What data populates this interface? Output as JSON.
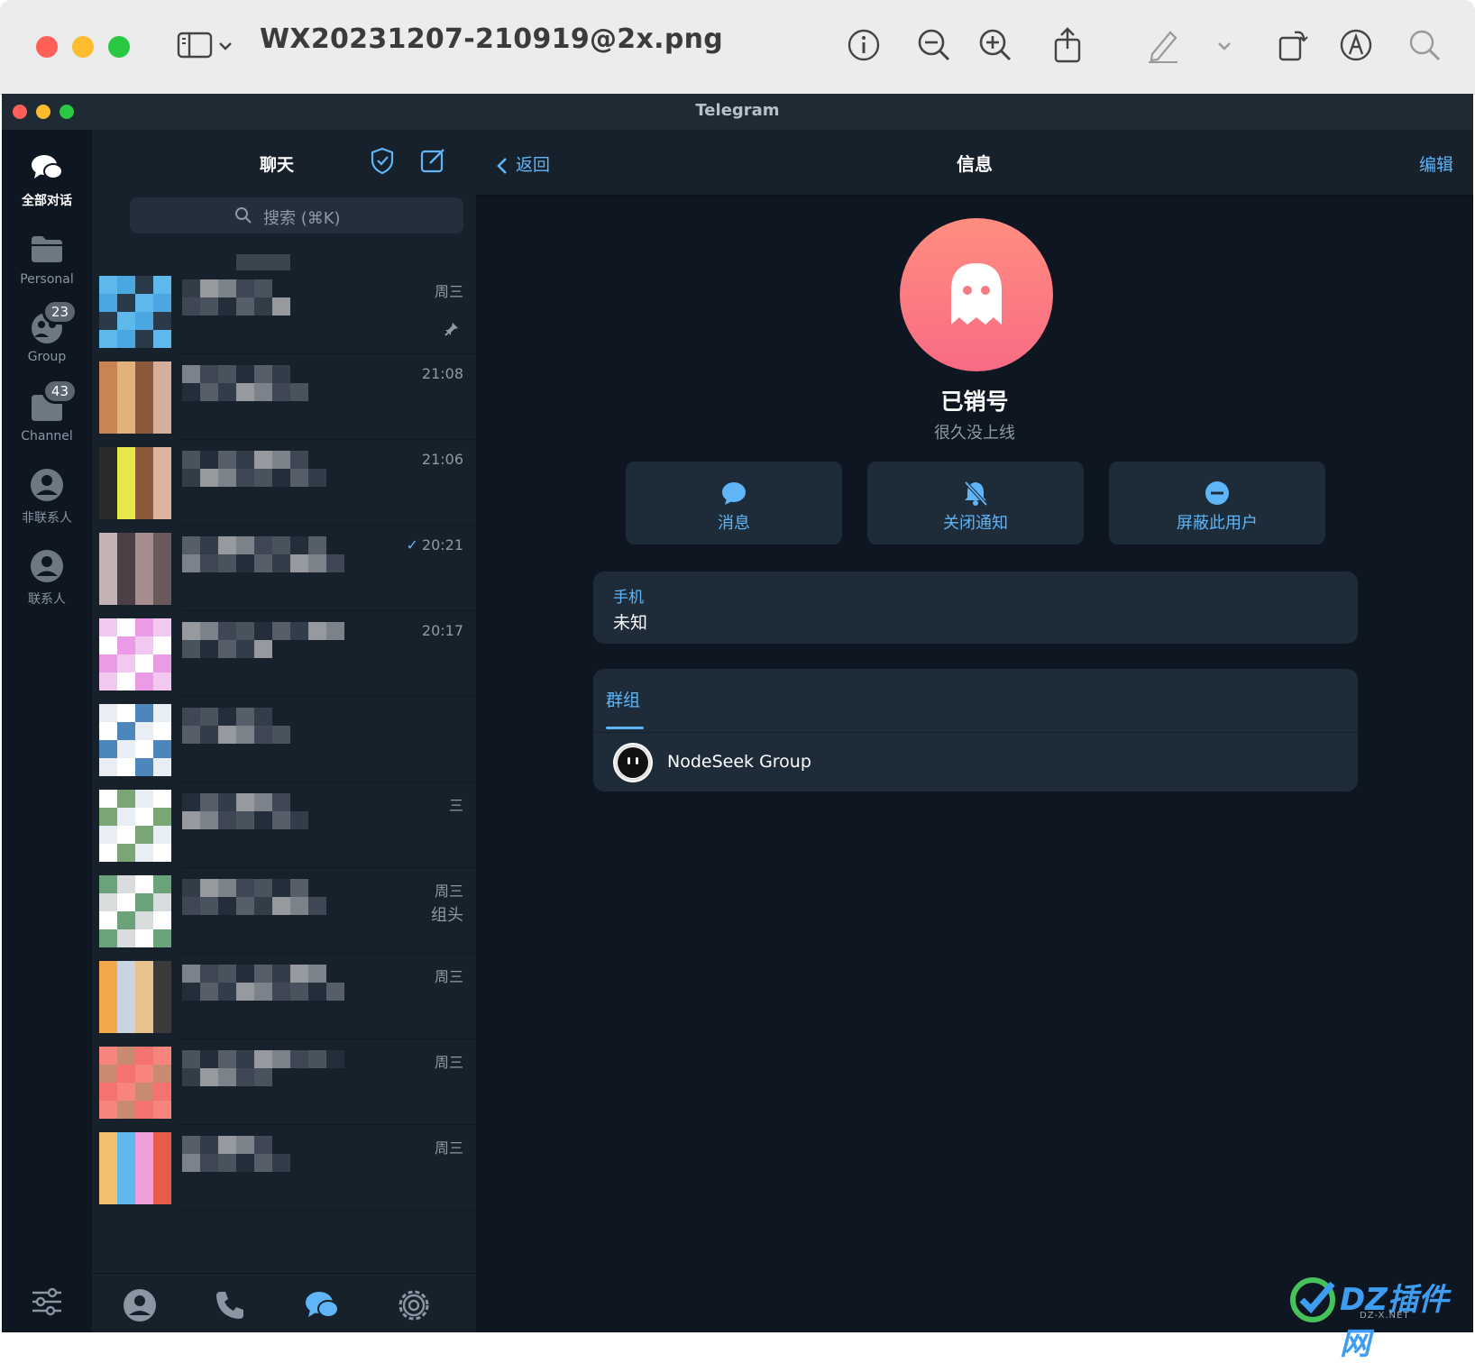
{
  "preview": {
    "file_title": "WX20231207-210919@2x.png",
    "toolbar_icons": [
      "sidebar-icon",
      "chevron-down-icon",
      "info-icon",
      "zoom-out-icon",
      "zoom-in-icon",
      "share-icon",
      "markup-pen-icon",
      "chevron-down-icon",
      "rotate-icon",
      "annotate-icon",
      "search-icon"
    ]
  },
  "telegram": {
    "window_title": "Telegram",
    "folders": [
      {
        "label": "全部对话",
        "icon": "chats-icon",
        "active": true
      },
      {
        "label": "Personal",
        "icon": "folder-icon"
      },
      {
        "label": "Group",
        "icon": "group-icon",
        "badge": "23"
      },
      {
        "label": "Channel",
        "icon": "channel-folder-icon",
        "badge": "43"
      },
      {
        "label": "非联系人",
        "icon": "person-icon"
      },
      {
        "label": "联系人",
        "icon": "person-icon"
      }
    ],
    "chat_list": {
      "title": "聊天",
      "search_placeholder": "搜索 (⌘K)",
      "rows": [
        {
          "time": "周三",
          "pinned": true
        },
        {
          "time": "21:08"
        },
        {
          "time": "21:06"
        },
        {
          "time": "20:21",
          "read_check": true
        },
        {
          "time": "20:17"
        },
        {
          "time": ""
        },
        {
          "time": "三"
        },
        {
          "time": "周三",
          "extra": "组头"
        },
        {
          "time": "周三"
        },
        {
          "time": "周三"
        },
        {
          "time": "周三"
        }
      ],
      "bottom_tabs": [
        "contacts-tab-icon",
        "calls-tab-icon",
        "chats-tab-icon",
        "settings-tab-icon"
      ]
    },
    "info": {
      "back_label": "返回",
      "title": "信息",
      "edit_label": "编辑",
      "name": "已销号",
      "status": "很久没上线",
      "actions": [
        {
          "label": "消息",
          "icon": "message-icon"
        },
        {
          "label": "关闭通知",
          "icon": "mute-bell-icon"
        },
        {
          "label": "屏蔽此用户",
          "icon": "block-icon"
        }
      ],
      "phone_label": "手机",
      "phone_value": "未知",
      "groups_tab": "群组",
      "groups": [
        {
          "name": "NodeSeek Group"
        }
      ]
    }
  },
  "watermark": {
    "text": "DZ插件网",
    "sub": "DZ-X.NET"
  },
  "colors": {
    "accent": "#5eb5f7",
    "bg": "#0e1621",
    "panel": "#1e2c3a",
    "avatar_top": "#ff8e7f",
    "avatar_bottom": "#f86b85"
  }
}
